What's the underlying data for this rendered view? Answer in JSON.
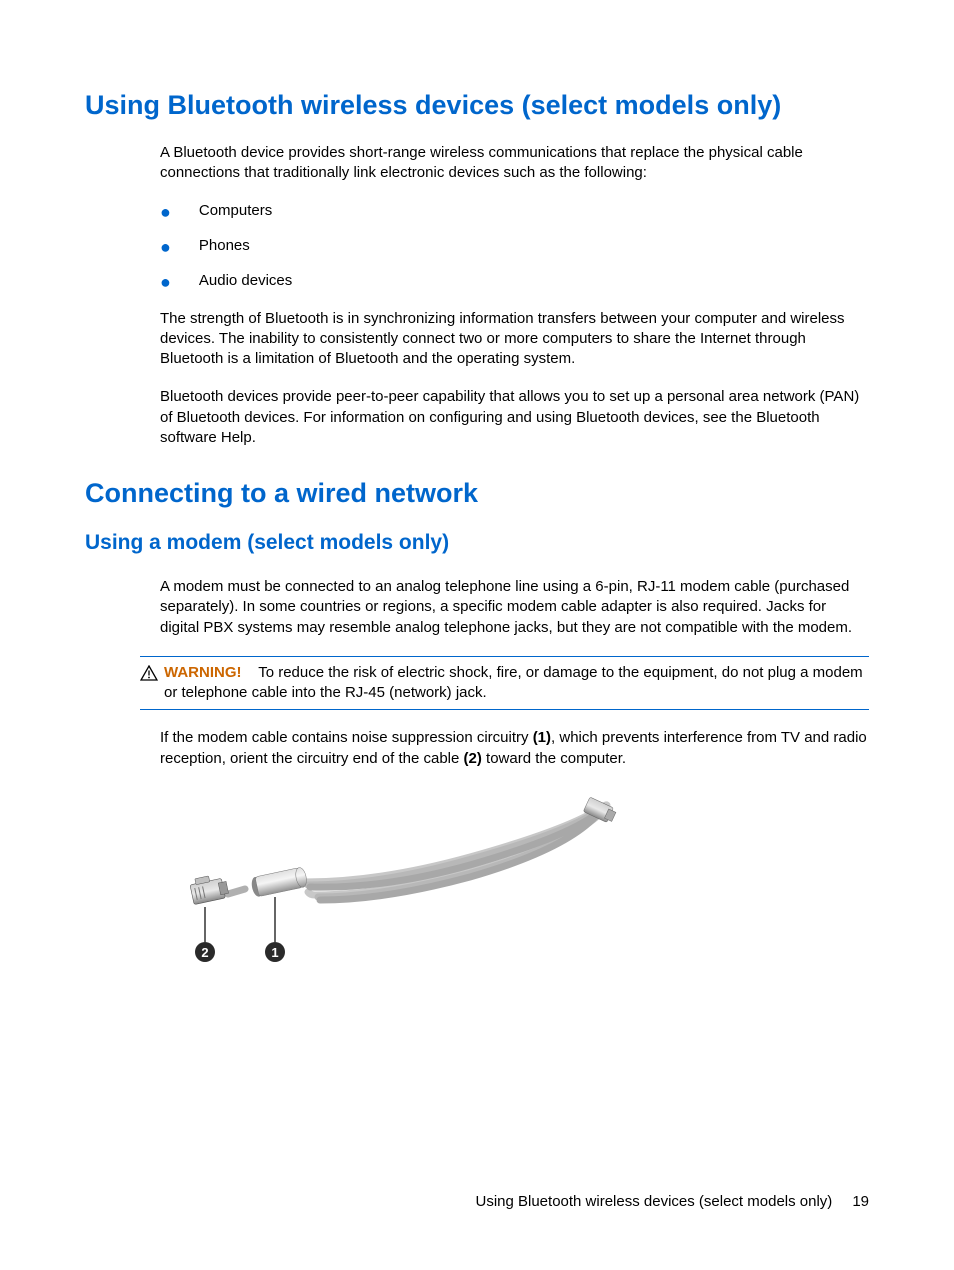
{
  "section1": {
    "heading": "Using Bluetooth wireless devices (select models only)",
    "intro": "A Bluetooth device provides short-range wireless communications that replace the physical cable connections that traditionally link electronic devices such as the following:",
    "bullets": [
      "Computers",
      "Phones",
      "Audio devices"
    ],
    "para2": "The strength of Bluetooth is in synchronizing information transfers between your computer and wireless devices. The inability to consistently connect two or more computers to share the Internet through Bluetooth is a limitation of Bluetooth and the operating system.",
    "para3": "Bluetooth devices provide peer-to-peer capability that allows you to set up a personal area network (PAN) of Bluetooth devices. For information on configuring and using Bluetooth devices, see the Bluetooth software Help."
  },
  "section2": {
    "heading": "Connecting to a wired network",
    "subheading": "Using a modem (select models only)",
    "para1": "A modem must be connected to an analog telephone line using a 6-pin, RJ-11 modem cable (purchased separately). In some countries or regions, a specific modem cable adapter is also required. Jacks for digital PBX systems may resemble analog telephone jacks, but they are not compatible with the modem.",
    "warning": {
      "label": "WARNING!",
      "text": "To reduce the risk of electric shock, fire, or damage to the equipment, do not plug a modem or telephone cable into the RJ-45 (network) jack."
    },
    "para2_pre": "If the modem cable contains noise suppression circuitry ",
    "para2_bold1": "(1)",
    "para2_mid": ", which prevents interference from TV and radio reception, orient the circuitry end of the cable ",
    "para2_bold2": "(2)",
    "para2_post": " toward the computer."
  },
  "callouts": {
    "label1": "1",
    "label2": "2"
  },
  "footer": {
    "title": "Using Bluetooth wireless devices (select models only)",
    "page": "19"
  }
}
